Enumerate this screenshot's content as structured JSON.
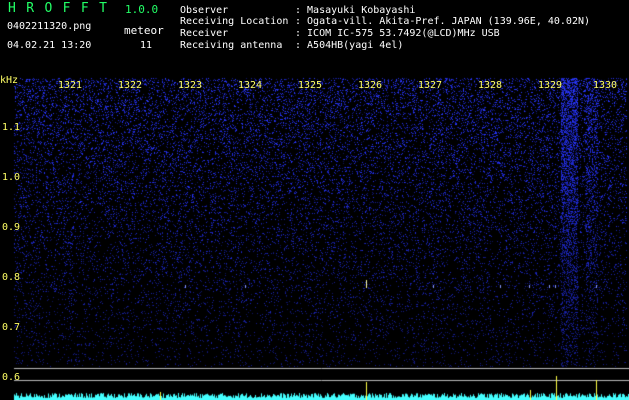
{
  "app": {
    "title": "HROFFT",
    "version": "1.0.0"
  },
  "file": {
    "name": "0402211320.png",
    "timestamp": "04.02.21 13:20"
  },
  "meteor": {
    "label": "meteor",
    "count": "11"
  },
  "meta": [
    {
      "key": "Observer",
      "value": ": Masayuki Kobayashi"
    },
    {
      "key": "Receiving Location",
      "value": ": Ogata-vill. Akita-Pref. JAPAN (139.96E, 40.02N)"
    },
    {
      "key": "Receiver",
      "value": ": ICOM IC-575 53.7492(@LCD)MHz USB"
    },
    {
      "key": "Receiving antenna",
      "value": ": A504HB(yagi 4el)"
    }
  ],
  "axis": {
    "unit": "kHz",
    "y_ticks": [
      "1.1",
      "1.0",
      "0.9",
      "0.8",
      "0.7",
      "0.6"
    ],
    "x_ticks": [
      "1321",
      "1322",
      "1323",
      "1324",
      "1325",
      "1326",
      "1327",
      "1328",
      "1329",
      "1330"
    ]
  },
  "colors": {
    "background": "#000000",
    "title_green": "#22ff66",
    "axis_yellow": "#ffff66",
    "noise_blue": "#3344ff",
    "signal_cyan": "#44ffff"
  }
}
